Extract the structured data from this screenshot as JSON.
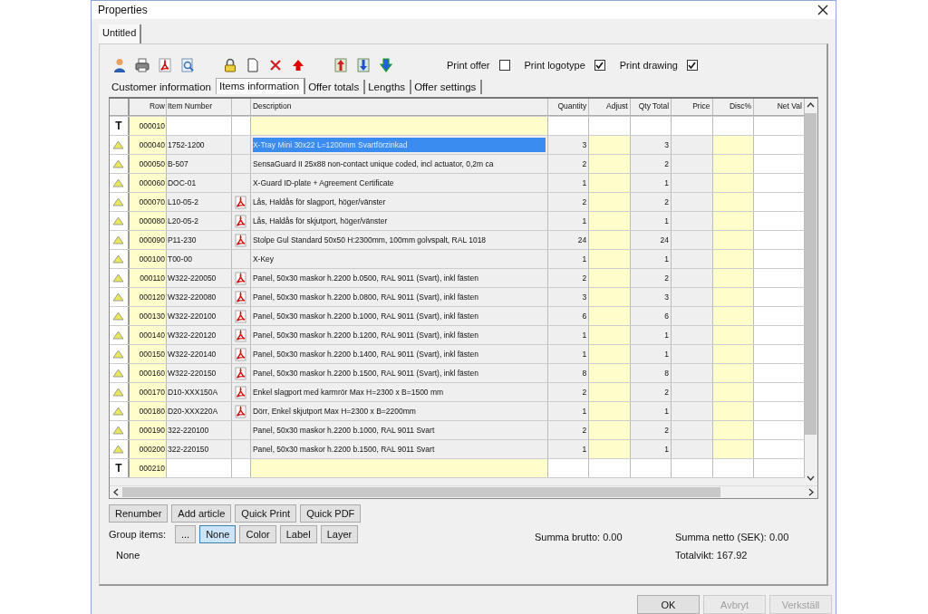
{
  "window": {
    "title": "Properties"
  },
  "document_tabs": [
    {
      "label": "Untitled",
      "selected": true
    }
  ],
  "toolbar": {
    "options": [
      {
        "label": "Print offer",
        "checked": false
      },
      {
        "label": "Print logotype",
        "checked": true
      },
      {
        "label": "Print drawing",
        "checked": true
      }
    ]
  },
  "tabs": [
    {
      "label": "Customer information",
      "selected": false
    },
    {
      "label": "Items information",
      "selected": true
    },
    {
      "label": "Offer totals",
      "selected": false
    },
    {
      "label": "Lengths",
      "selected": false
    },
    {
      "label": "Offer settings",
      "selected": false
    }
  ],
  "table": {
    "columns": [
      "Row",
      "Item Number",
      "Description",
      "Quantity",
      "Adjust",
      "Qty Total",
      "Price",
      "Disc%",
      "Net Val"
    ],
    "rows": [
      {
        "kind": "text",
        "marker": "T",
        "row": "000010",
        "item_number": "",
        "pdf": false,
        "description": "",
        "quantity": "",
        "qty_total": "",
        "selected": false
      },
      {
        "kind": "item",
        "row": "000040",
        "item_number": "1752-1200",
        "pdf": false,
        "description": "X-Tray Mini 30x22 L=1200mm Svartförzinkad",
        "quantity": "3",
        "qty_total": "3",
        "selected": true
      },
      {
        "kind": "item",
        "row": "000050",
        "item_number": "B-507",
        "pdf": false,
        "description": "SensaGuard II 25x88 non-contact unique coded, incl actuator, 0,2m ca",
        "quantity": "2",
        "qty_total": "2",
        "selected": false
      },
      {
        "kind": "item",
        "row": "000060",
        "item_number": "DOC-01",
        "pdf": false,
        "description": "X-Guard ID-plate + Agreement Certificate",
        "quantity": "1",
        "qty_total": "1",
        "selected": false
      },
      {
        "kind": "item",
        "row": "000070",
        "item_number": "L10-05-2",
        "pdf": true,
        "description": "Lås, Haldås för slagport, höger/vänster",
        "quantity": "2",
        "qty_total": "2",
        "selected": false
      },
      {
        "kind": "item",
        "row": "000080",
        "item_number": "L20-05-2",
        "pdf": true,
        "description": "Lås, Haldås för skjutport, höger/vänster",
        "quantity": "1",
        "qty_total": "1",
        "selected": false
      },
      {
        "kind": "item",
        "row": "000090",
        "item_number": "P11-230",
        "pdf": true,
        "description": "Stolpe Gul Standard 50x50 H:2300mm, 100mm golvspalt, RAL 1018",
        "quantity": "24",
        "qty_total": "24",
        "selected": false
      },
      {
        "kind": "item",
        "row": "000100",
        "item_number": "T00-00",
        "pdf": false,
        "description": "X-Key",
        "quantity": "1",
        "qty_total": "1",
        "selected": false
      },
      {
        "kind": "item",
        "row": "000110",
        "item_number": "W322-220050",
        "pdf": true,
        "description": "Panel, 50x30 maskor h.2200 b.0500, RAL 9011 (Svart), inkl fästen",
        "quantity": "2",
        "qty_total": "2",
        "selected": false
      },
      {
        "kind": "item",
        "row": "000120",
        "item_number": "W322-220080",
        "pdf": true,
        "description": "Panel, 50x30 maskor h.2200 b.0800, RAL 9011 (Svart), inkl fästen",
        "quantity": "3",
        "qty_total": "3",
        "selected": false
      },
      {
        "kind": "item",
        "row": "000130",
        "item_number": "W322-220100",
        "pdf": true,
        "description": "Panel, 50x30 maskor h.2200 b.1000, RAL 9011 (Svart), inkl fästen",
        "quantity": "6",
        "qty_total": "6",
        "selected": false
      },
      {
        "kind": "item",
        "row": "000140",
        "item_number": "W322-220120",
        "pdf": true,
        "description": "Panel, 50x30 maskor h.2200 b.1200, RAL 9011 (Svart), inkl fästen",
        "quantity": "1",
        "qty_total": "1",
        "selected": false
      },
      {
        "kind": "item",
        "row": "000150",
        "item_number": "W322-220140",
        "pdf": true,
        "description": "Panel, 50x30 maskor h.2200 b.1400, RAL 9011 (Svart), inkl fästen",
        "quantity": "1",
        "qty_total": "1",
        "selected": false
      },
      {
        "kind": "item",
        "row": "000160",
        "item_number": "W322-220150",
        "pdf": true,
        "description": "Panel, 50x30 maskor h.2200 b.1500, RAL 9011 (Svart), inkl fästen",
        "quantity": "8",
        "qty_total": "8",
        "selected": false
      },
      {
        "kind": "item",
        "row": "000170",
        "item_number": "D10-XXX150A",
        "pdf": true,
        "description": "Enkel slagport med karmrör Max H=2300 x B=1500 mm",
        "quantity": "2",
        "qty_total": "2",
        "selected": false
      },
      {
        "kind": "item",
        "row": "000180",
        "item_number": "D20-XXX220A",
        "pdf": true,
        "description": "Dörr, Enkel skjutport Max H=2300 x B=2200mm",
        "quantity": "1",
        "qty_total": "1",
        "selected": false
      },
      {
        "kind": "item",
        "row": "000190",
        "item_number": "322-220100",
        "pdf": false,
        "description": "Panel, 50x30 maskor h.2200 b.1000, RAL 9011 Svart",
        "quantity": "2",
        "qty_total": "2",
        "selected": false
      },
      {
        "kind": "item",
        "row": "000200",
        "item_number": "322-220150",
        "pdf": false,
        "description": "Panel, 50x30 maskor h.2200 b.1500, RAL 9011 Svart",
        "quantity": "1",
        "qty_total": "1",
        "selected": false
      },
      {
        "kind": "text",
        "marker": "T",
        "row": "000210",
        "item_number": "",
        "pdf": false,
        "description": "",
        "quantity": "",
        "qty_total": "",
        "selected": false
      }
    ]
  },
  "actions": [
    "Renumber",
    "Add article",
    "Quick Print",
    "Quick PDF"
  ],
  "group_items": {
    "label": "Group items:",
    "options": [
      {
        "label": "...",
        "selected": false
      },
      {
        "label": "None",
        "selected": true
      },
      {
        "label": "Color",
        "selected": false
      },
      {
        "label": "Label",
        "selected": false
      },
      {
        "label": "Layer",
        "selected": false
      }
    ],
    "current": "None"
  },
  "totals": {
    "gross": "Summa brutto: 0.00",
    "net": "Summa netto (SEK): 0.00",
    "weight": "Totalvikt: 167.92"
  },
  "buttons": [
    {
      "label": "OK",
      "disabled": false
    },
    {
      "label": "Avbryt",
      "disabled": true
    },
    {
      "label": "Verkställ",
      "disabled": true
    }
  ]
}
